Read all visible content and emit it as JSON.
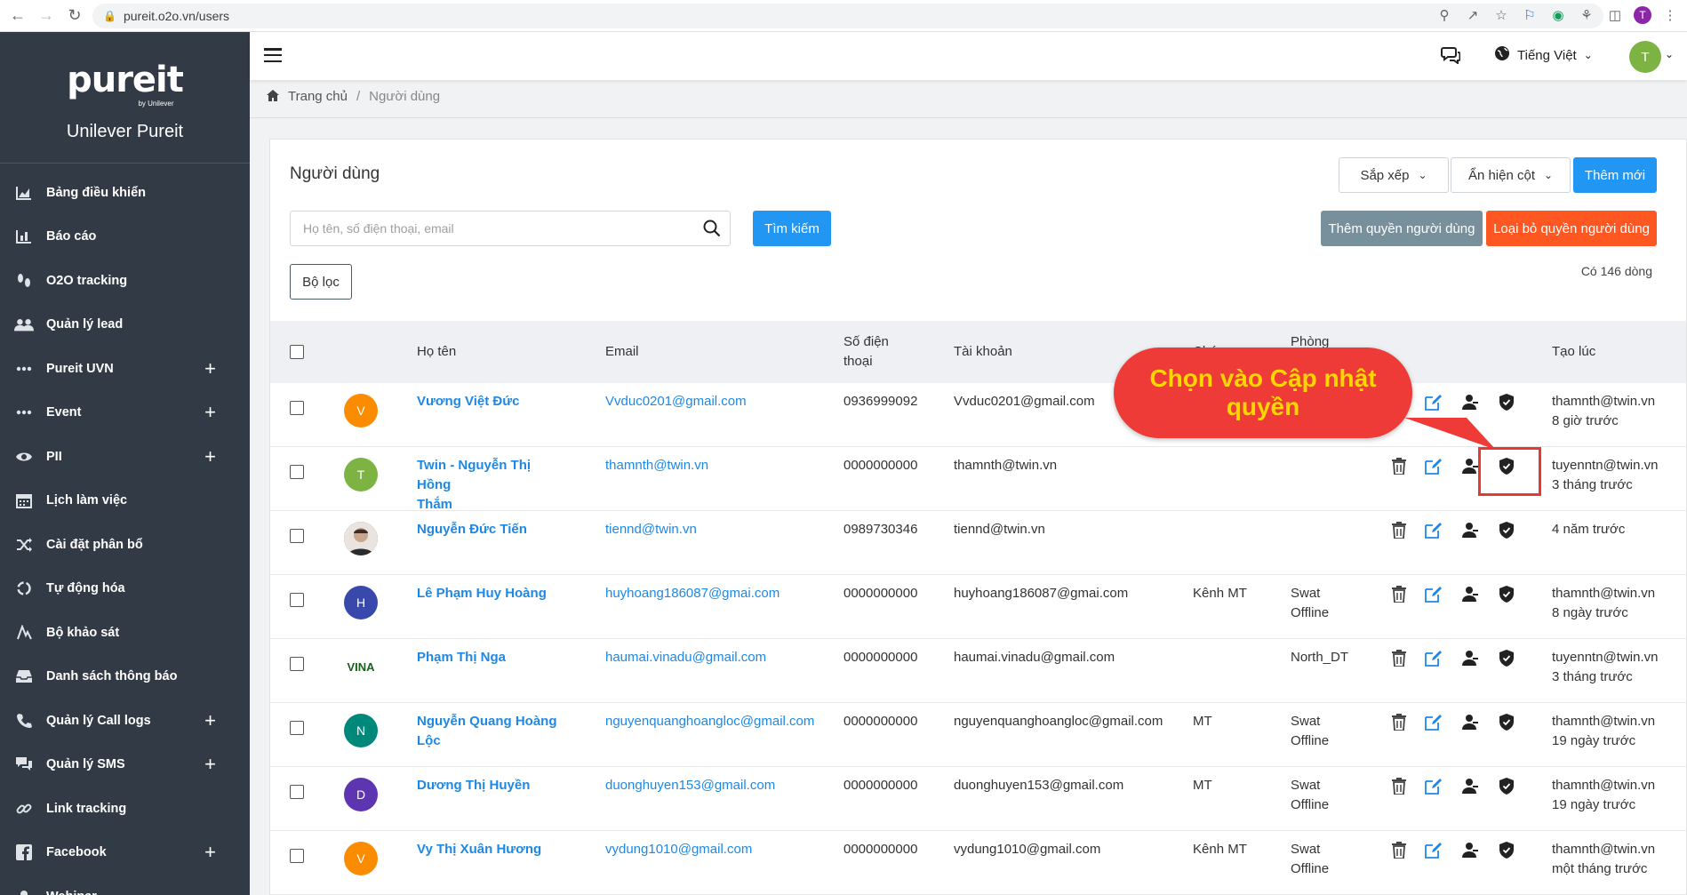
{
  "browser": {
    "url": "pureit.o2o.vn/users",
    "profile_initial": "T"
  },
  "sidebar": {
    "logo_text": "pureit",
    "logo_sub": "by Unilever",
    "brand_name": "Unilever Pureit",
    "items": [
      {
        "label": "Bảng điều khiển",
        "icon": "chart-area-icon",
        "plus": ""
      },
      {
        "label": "Báo cáo",
        "icon": "bar-chart-icon",
        "plus": ""
      },
      {
        "label": "O2O tracking",
        "icon": "footsteps-icon",
        "plus": ""
      },
      {
        "label": "Quản lý lead",
        "icon": "users-icon",
        "plus": ""
      },
      {
        "label": "Pureit UVN",
        "icon": "dots-icon",
        "plus": "+"
      },
      {
        "label": "Event",
        "icon": "dots-icon",
        "plus": "+"
      },
      {
        "label": "PII",
        "icon": "eye-icon",
        "plus": "+"
      },
      {
        "label": "Lịch làm việc",
        "icon": "calendar-icon",
        "plus": ""
      },
      {
        "label": "Cài đặt phân bổ",
        "icon": "shuffle-icon",
        "plus": ""
      },
      {
        "label": "Tự động hóa",
        "icon": "cycle-icon",
        "plus": ""
      },
      {
        "label": "Bộ khảo sát",
        "icon": "survey-icon",
        "plus": ""
      },
      {
        "label": "Danh sách thông báo",
        "icon": "inbox-icon",
        "plus": ""
      },
      {
        "label": "Quản lý Call logs",
        "icon": "phone-icon",
        "plus": "+"
      },
      {
        "label": "Quản lý SMS",
        "icon": "chat-icon",
        "plus": "+"
      },
      {
        "label": "Link tracking",
        "icon": "link-icon",
        "plus": ""
      },
      {
        "label": "Facebook",
        "icon": "facebook-icon",
        "plus": "+"
      },
      {
        "label": "Webinar",
        "icon": "webinar-icon",
        "plus": ""
      }
    ]
  },
  "header": {
    "language": "Tiếng Việt",
    "user_initial": "T"
  },
  "breadcrumb": {
    "home": "Trang chủ",
    "separator": "/",
    "current": "Người dùng"
  },
  "page": {
    "title": "Người dùng",
    "sort_label": "Sắp xếp",
    "columns_label": "Ẩn hiện cột",
    "add_label": "Thêm mới",
    "search_placeholder": "Họ tên, số điện thoại, email",
    "search_button": "Tìm kiếm",
    "add_permission_button": "Thêm quyền người dùng",
    "remove_permission_button": "Loại bỏ quyền người dùng",
    "filter_button": "Bộ lọc",
    "row_count": "Có 146 dòng"
  },
  "table": {
    "headers": {
      "name": "Họ tên",
      "email": "Email",
      "phone_1": "Số điện",
      "phone_2": "thoại",
      "account": "Tài khoản",
      "position": "Chức vụ",
      "department": "Phòng",
      "created": "Tạo lúc"
    },
    "rows": [
      {
        "initial": "V",
        "avatar_color": "#fb8c00",
        "name_1": "Vương Việt Đức",
        "name_2": "",
        "email": "Vvduc0201@gmail.com",
        "phone": "0936999092",
        "account": "Vvduc0201@gmail.com",
        "position": "",
        "dept_1": "",
        "dept_2": "",
        "created_by": "thamnth@twin.vn",
        "created_ago": "8 giờ trước"
      },
      {
        "initial": "T",
        "avatar_color": "#7cb342",
        "name_1": "Twin - Nguyễn Thị Hồng",
        "name_2": "Thắm",
        "email": "thamnth@twin.vn",
        "phone": "0000000000",
        "account": "thamnth@twin.vn",
        "position": "",
        "dept_1": "",
        "dept_2": "",
        "created_by": "tuyenntn@twin.vn",
        "created_ago": "3 tháng trước"
      },
      {
        "initial": "",
        "avatar_color": "photo",
        "name_1": "Nguyễn Đức Tiến",
        "name_2": "",
        "email": "tiennd@twin.vn",
        "phone": "0989730346",
        "account": "tiennd@twin.vn",
        "position": "",
        "dept_1": "",
        "dept_2": "",
        "created_by": "",
        "created_ago": "4 năm trước"
      },
      {
        "initial": "H",
        "avatar_color": "#3949ab",
        "name_1": "Lê Phạm Huy Hoàng",
        "name_2": "",
        "email": "huyhoang186087@gmai.com",
        "phone": "0000000000",
        "account": "huyhoang186087@gmai.com",
        "position": "Kênh MT",
        "dept_1": "Swat",
        "dept_2": "Offline",
        "created_by": "thamnth@twin.vn",
        "created_ago": "8 ngày trước"
      },
      {
        "initial": "",
        "avatar_color": "logo",
        "logo_text": "VINA",
        "name_1": "Phạm Thị Nga",
        "name_2": "",
        "email": "haumai.vinadu@gmail.com",
        "phone": "0000000000",
        "account": "haumai.vinadu@gmail.com",
        "position": "",
        "dept_1": "North_DT",
        "dept_2": "",
        "created_by": "tuyenntn@twin.vn",
        "created_ago": "3 tháng trước"
      },
      {
        "initial": "N",
        "avatar_color": "#00897b",
        "name_1": "Nguyễn Quang Hoàng Lộc",
        "name_2": "",
        "email": "nguyenquanghoangloc@gmail.com",
        "phone": "0000000000",
        "account": "nguyenquanghoangloc@gmail.com",
        "position": "MT",
        "dept_1": "Swat",
        "dept_2": "Offline",
        "created_by": "thamnth@twin.vn",
        "created_ago": "19 ngày trước"
      },
      {
        "initial": "D",
        "avatar_color": "#5e35b1",
        "name_1": "Dương Thị Huyền",
        "name_2": "",
        "email": "duonghuyen153@gmail.com",
        "phone": "0000000000",
        "account": "duonghuyen153@gmail.com",
        "position": "MT",
        "dept_1": "Swat",
        "dept_2": "Offline",
        "created_by": "thamnth@twin.vn",
        "created_ago": "19 ngày trước"
      },
      {
        "initial": "V",
        "avatar_color": "#fb8c00",
        "name_1": "Vy Thị Xuân Hương",
        "name_2": "",
        "email": "vydung1010@gmail.com",
        "phone": "0000000000",
        "account": "vydung1010@gmail.com",
        "position": "Kênh MT",
        "dept_1": "Swat",
        "dept_2": "Offline",
        "created_by": "thamnth@twin.vn",
        "created_ago": "một tháng trước"
      }
    ]
  },
  "callout": {
    "line_1": "Chọn vào Cập nhật",
    "line_2": "quyền"
  }
}
